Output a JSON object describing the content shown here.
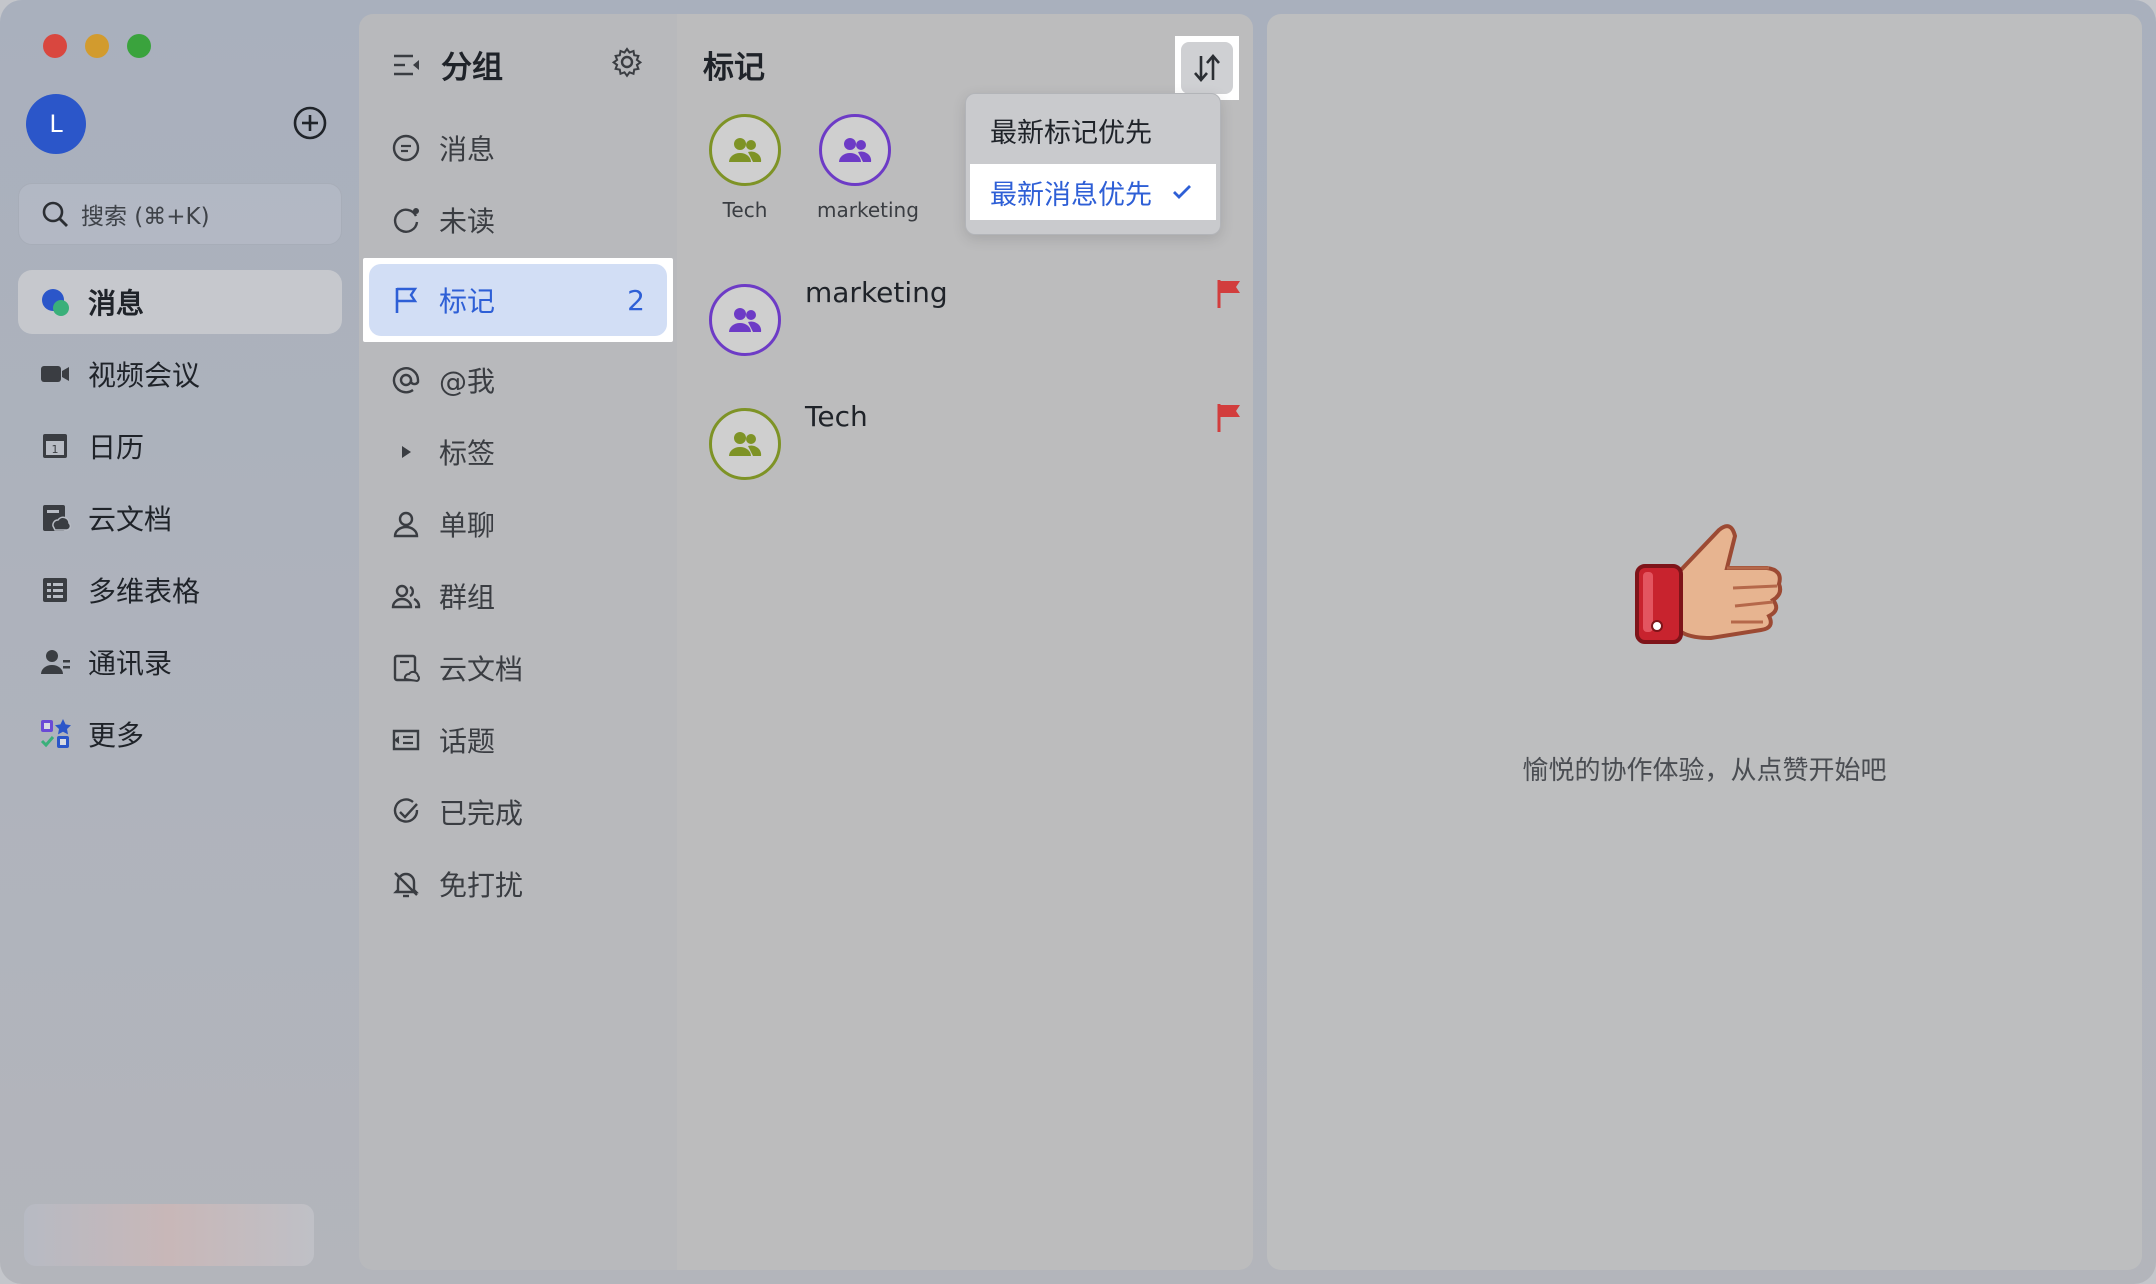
{
  "sidebar": {
    "avatar_letter": "L",
    "search_placeholder": "搜索 (⌘+K)",
    "nav": [
      {
        "label": "消息",
        "icon": "chat-bubble-icon"
      },
      {
        "label": "视频会议",
        "icon": "video-camera-icon"
      },
      {
        "label": "日历",
        "icon": "calendar-icon"
      },
      {
        "label": "云文档",
        "icon": "cloud-doc-icon"
      },
      {
        "label": "多维表格",
        "icon": "table-icon"
      },
      {
        "label": "通讯录",
        "icon": "contacts-icon"
      },
      {
        "label": "更多",
        "icon": "apps-grid-icon"
      }
    ]
  },
  "groups": {
    "title": "分组",
    "items": [
      {
        "label": "消息",
        "icon": "message-icon"
      },
      {
        "label": "未读",
        "icon": "unread-icon"
      },
      {
        "label": "标记",
        "icon": "flag-outline-icon",
        "count": "2"
      },
      {
        "label": "@我",
        "icon": "at-icon"
      },
      {
        "label": "标签",
        "icon": "triangle-right-icon"
      },
      {
        "label": "单聊",
        "icon": "person-icon"
      },
      {
        "label": "群组",
        "icon": "people-icon"
      },
      {
        "label": "云文档",
        "icon": "doc-icon"
      },
      {
        "label": "话题",
        "icon": "topic-icon"
      },
      {
        "label": "已完成",
        "icon": "done-icon"
      },
      {
        "label": "免打扰",
        "icon": "bell-off-icon"
      }
    ]
  },
  "flagged": {
    "title": "标记",
    "recent": [
      {
        "name": "Tech",
        "ring": "#7e9326"
      },
      {
        "name": "marketing",
        "ring": "#6d3bc6"
      }
    ],
    "rows": [
      {
        "name": "marketing",
        "ring": "#6d3bc6"
      },
      {
        "name": "Tech",
        "ring": "#7e9326"
      }
    ]
  },
  "sort_menu": {
    "options": [
      "最新标记优先",
      "最新消息优先"
    ],
    "selected": "最新消息优先"
  },
  "detail": {
    "empty_text": "愉悦的协作体验，从点赞开始吧"
  },
  "colors": {
    "accent": "#2e5fd6",
    "flag": "#d23d3d"
  }
}
